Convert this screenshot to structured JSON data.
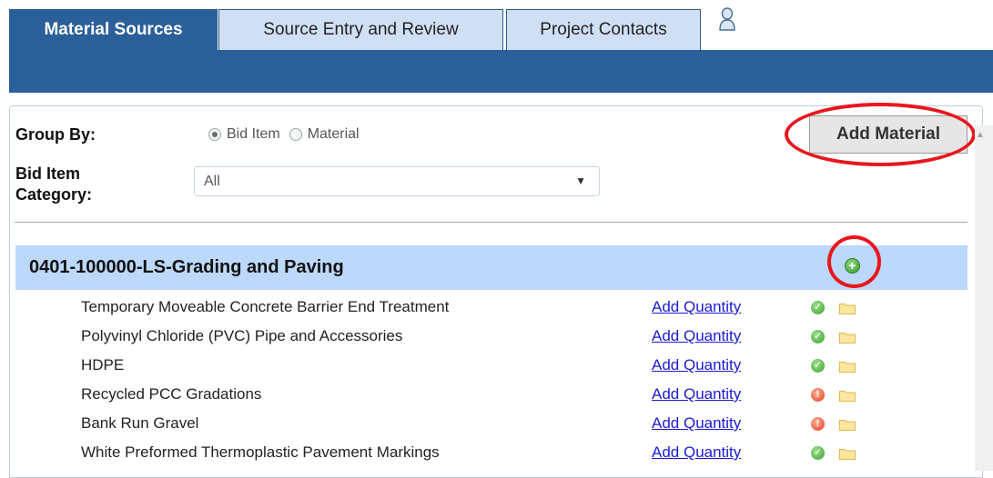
{
  "tabs": [
    {
      "label": "Material Sources",
      "active": true
    },
    {
      "label": "Source Entry and Review",
      "active": false
    },
    {
      "label": "Project Contacts",
      "active": false
    }
  ],
  "user_icon": "user-icon",
  "filters": {
    "group_by_label": "Group By:",
    "group_by_options": [
      "Bid Item",
      "Material"
    ],
    "group_by_selected": "Bid Item",
    "bid_item_category_label_line1": "Bid Item",
    "bid_item_category_label_line2": "Category:",
    "bid_item_category_value": "All"
  },
  "add_material_label": "Add Material",
  "group": {
    "title": "0401-100000-LS-Grading and Paving",
    "add_icon": "plus-circle-icon",
    "items": [
      {
        "name": "Temporary Moveable Concrete Barrier End Treatment",
        "link": "Add Quantity",
        "status": "ok"
      },
      {
        "name": "Polyvinyl Chloride (PVC) Pipe and Accessories",
        "link": "Add Quantity",
        "status": "ok"
      },
      {
        "name": "HDPE",
        "link": "Add Quantity",
        "status": "ok"
      },
      {
        "name": "Recycled PCC Gradations",
        "link": "Add Quantity",
        "status": "warning"
      },
      {
        "name": "Bank Run Gravel",
        "link": "Add Quantity",
        "status": "warning"
      },
      {
        "name": "White Preformed Thermoplastic Pavement Markings",
        "link": "Add Quantity",
        "status": "ok"
      }
    ]
  },
  "colors": {
    "tab_active": "#2a5f99",
    "tab_inactive": "#cfe0f5",
    "group_header": "#bcd8fb",
    "highlight_ring": "#e8171d",
    "link": "#1a1ad6"
  }
}
